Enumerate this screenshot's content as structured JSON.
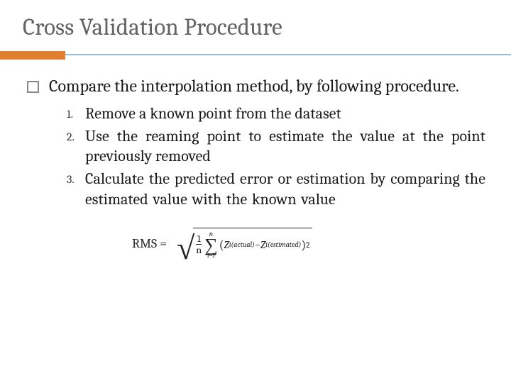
{
  "title": "Cross Validation Procedure",
  "intro": "Compare the interpolation method, by following procedure.",
  "items": [
    {
      "num": "1.",
      "text": "Remove a known point from the dataset"
    },
    {
      "num": "2.",
      "text": "Use the reaming point to estimate the value at the point previously removed"
    },
    {
      "num": "3.",
      "text": "Calculate the predicted error or estimation by comparing the estimated value with the known value"
    }
  ],
  "formula": {
    "label": "RMS  =",
    "frac_num": "1",
    "frac_den": "n",
    "sum_upper": "n",
    "sum_lower": "i=1",
    "z_actual": "Z",
    "sub_actual": "i(actual)",
    "minus": " − ",
    "z_est": "Z",
    "sub_est": "i(estimated)",
    "square": "2"
  }
}
